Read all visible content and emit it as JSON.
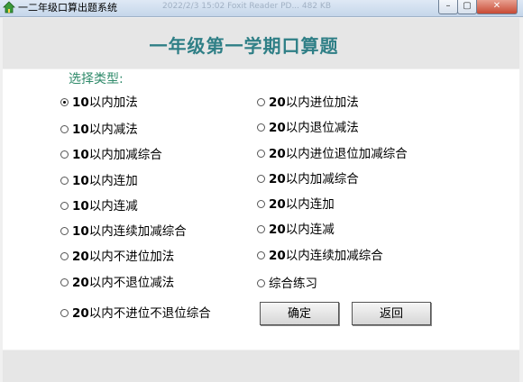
{
  "window": {
    "title": "一二年级口算出题系统",
    "ghost_taskbar": "2022/2/3  15:02     Foxit Reader PD...     482 KB",
    "min_glyph": "–",
    "max_glyph": "▢",
    "close_glyph": "✕"
  },
  "heading": "一年级第一学期口算题",
  "section_label": "选择类型:",
  "options_left": [
    {
      "num": "10",
      "text": "以内加法",
      "selected": true
    },
    {
      "num": "10",
      "text": "以内减法",
      "selected": false
    },
    {
      "num": "10",
      "text": "以内加减综合",
      "selected": false
    },
    {
      "num": "10",
      "text": "以内连加",
      "selected": false
    },
    {
      "num": "10",
      "text": "以内连减",
      "selected": false
    },
    {
      "num": "10",
      "text": "以内连续加减综合",
      "selected": false
    },
    {
      "num": "20",
      "text": "以内不进位加法",
      "selected": false
    },
    {
      "num": "20",
      "text": "以内不退位减法",
      "selected": false
    },
    {
      "num": "20",
      "text": "以内不进位不退位综合",
      "selected": false
    }
  ],
  "options_right": [
    {
      "num": "20",
      "text": "以内进位加法",
      "selected": false
    },
    {
      "num": "20",
      "text": "以内退位减法",
      "selected": false
    },
    {
      "num": "20",
      "text": "以内进位退位加减综合",
      "selected": false
    },
    {
      "num": "20",
      "text": "以内加减综合",
      "selected": false
    },
    {
      "num": "20",
      "text": "以内连加",
      "selected": false
    },
    {
      "num": "20",
      "text": "以内连减",
      "selected": false
    },
    {
      "num": "20",
      "text": "以内连续加减综合",
      "selected": false
    },
    {
      "num": "",
      "text": "综合练习",
      "selected": false
    }
  ],
  "buttons": {
    "confirm": "确定",
    "back": "返回"
  }
}
